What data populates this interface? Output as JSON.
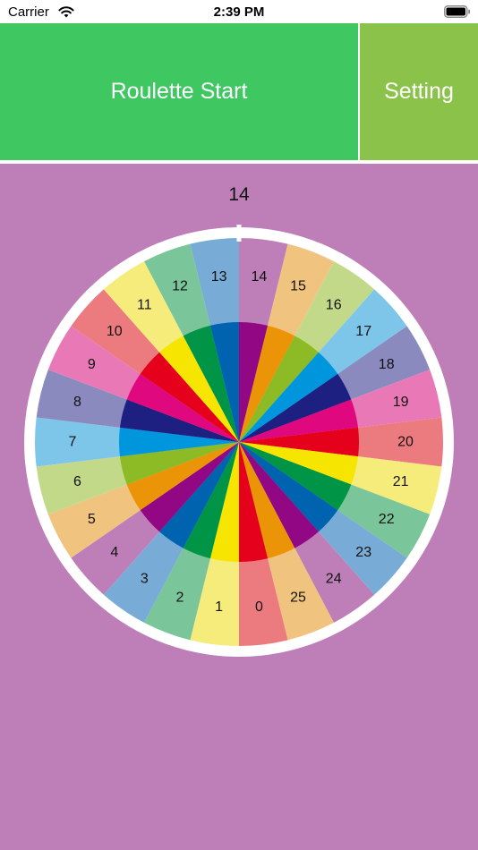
{
  "status_bar": {
    "carrier": "Carrier",
    "time": "2:39 PM"
  },
  "toolbar": {
    "start_label": "Roulette Start",
    "setting_label": "Setting",
    "start_color": "#3FC762",
    "setting_color": "#8BC34A"
  },
  "background_color": "#BE7FB9",
  "result": "14",
  "wheel": {
    "labels": [
      "14",
      "15",
      "16",
      "17",
      "18",
      "19",
      "20",
      "21",
      "22",
      "23",
      "24",
      "25",
      "0",
      "1",
      "2",
      "3",
      "4",
      "5",
      "6",
      "7",
      "8",
      "9",
      "10",
      "11",
      "12",
      "13"
    ],
    "outer_colors": [
      "#BE7FB9",
      "#F0C37E",
      "#C3D98A",
      "#7DC6EA",
      "#8A8ABF",
      "#E879B6",
      "#EC7B80",
      "#F6EC7B",
      "#7AC59A",
      "#78ACD6",
      "#BE7FB9",
      "#F0C37E",
      "#EC7B80",
      "#F6EC7B",
      "#7AC59A",
      "#78ACD6",
      "#BE7FB9",
      "#F0C37E",
      "#C3D98A",
      "#7DC6EA",
      "#8A8ABF",
      "#E879B6",
      "#EC7B80",
      "#F6EC7B",
      "#7AC59A",
      "#78ACD6"
    ],
    "inner_colors": [
      "#920783",
      "#EC9407",
      "#8CBB25",
      "#0096DE",
      "#1D1F81",
      "#E0087F",
      "#E5001B",
      "#F6E500",
      "#009447",
      "#0063B0",
      "#920783",
      "#EC9407",
      "#E5001B",
      "#F6E500",
      "#009447",
      "#0063B0",
      "#920783",
      "#EC9407",
      "#8CBB25",
      "#0096DE",
      "#1D1F81",
      "#E0087F",
      "#E5001B",
      "#F6E500",
      "#009447",
      "#0063B0"
    ]
  }
}
